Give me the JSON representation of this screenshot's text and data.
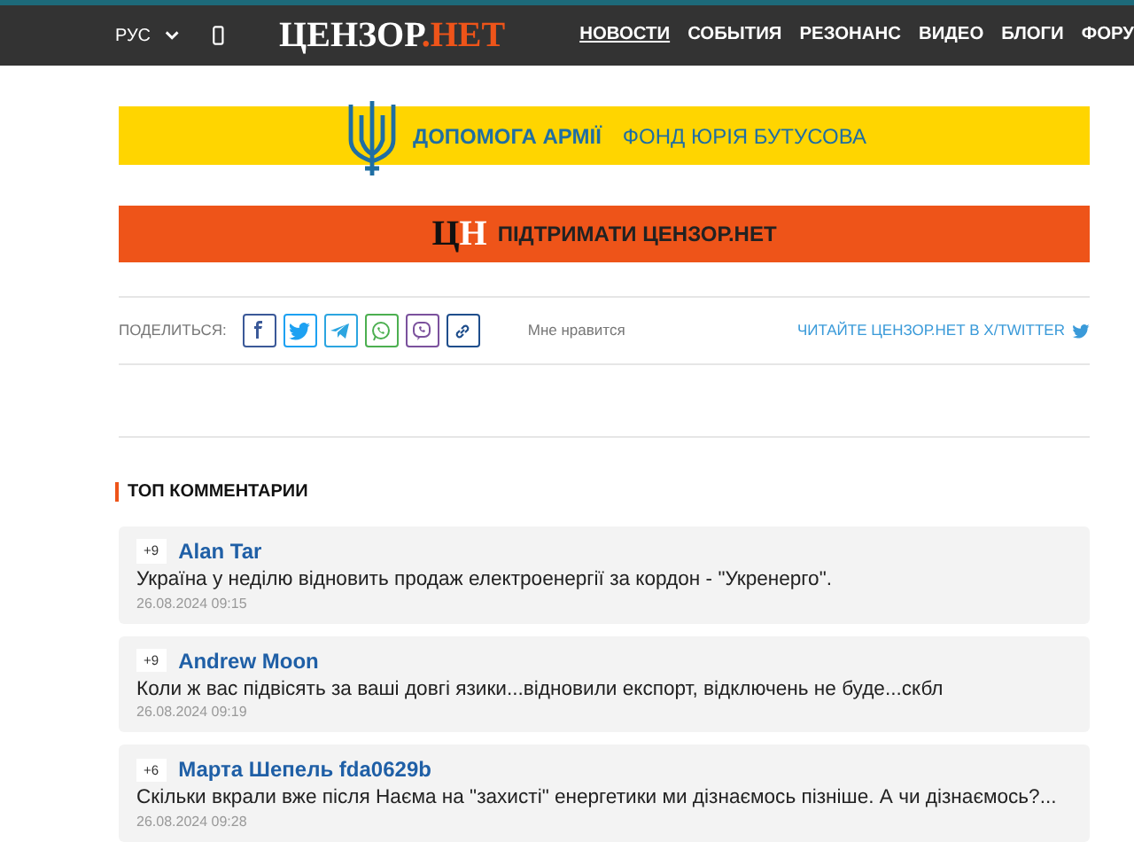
{
  "header": {
    "language": "РУС",
    "logo": {
      "main": "ЦЕНЗОР",
      "accent": ".НЕТ"
    },
    "nav": [
      {
        "label": "НОВОСТИ",
        "selected": true
      },
      {
        "label": "СОБЫТИЯ",
        "selected": false
      },
      {
        "label": "РЕЗОНАНС",
        "selected": false
      },
      {
        "label": "ВИДЕО",
        "selected": false
      },
      {
        "label": "БЛОГИ",
        "selected": false
      },
      {
        "label": "ФОРУ",
        "selected": false
      }
    ]
  },
  "army_banner": {
    "title": "ДОПОМОГА АРМІЇ",
    "subtitle": "ФОНД ЮРІЯ БУТУСОВА"
  },
  "support_banner": {
    "logo": [
      "Ц",
      "Н"
    ],
    "label": "ПІДТРИМАТИ ЦЕНЗОР.НЕТ"
  },
  "share": {
    "label": "ПОДЕЛИТЬСЯ:",
    "buttons": [
      {
        "kind": "facebook",
        "color": "#3b5998"
      },
      {
        "kind": "twitter",
        "color": "#1da1f2"
      },
      {
        "kind": "telegram",
        "color": "#2ca5e0"
      },
      {
        "kind": "whatsapp",
        "color": "#4caf50"
      },
      {
        "kind": "viber",
        "color": "#7b519d"
      },
      {
        "kind": "link",
        "color": "#1f4e8c"
      }
    ],
    "like": "Мне нравится",
    "follow": "ЧИТАЙТЕ ЦЕНЗОР.НЕТ В X/TWITTER"
  },
  "top_comments": {
    "title": "ТОП КОММЕНТАРИИ",
    "items": [
      {
        "votes": "+9",
        "author": "Alan Tar",
        "text": "Україна у неділю відновить продаж електроенергії за кордон - \"Укренерго\".",
        "date": "26.08.2024 09:15"
      },
      {
        "votes": "+9",
        "author": "Andrew Moon",
        "text": "Коли ж вас підвісять за ваші довгі язики...відновили експорт, відключень не буде...скбл",
        "date": "26.08.2024 09:19"
      },
      {
        "votes": "+6",
        "author": "Марта Шепель fda0629b",
        "text": "Скільки вкрали вже після Наєма на \"захисті\" енергетики ми дізнаємось пізніше. А чи дізнаємось?...",
        "date": "26.08.2024 09:28"
      }
    ]
  }
}
